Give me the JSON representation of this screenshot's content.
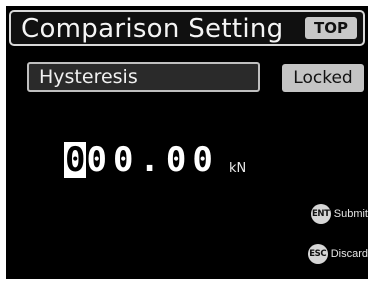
{
  "header": {
    "title": "Comparison Setting",
    "top_button": "TOP"
  },
  "field": {
    "mode": "Hysteresis",
    "lock_status": "Locked"
  },
  "value": {
    "cursor_digit": "0",
    "rest": "00.00",
    "unit": "kN"
  },
  "keys": [
    {
      "key": "ENT",
      "label": "Submit"
    },
    {
      "key": "ESC",
      "label": "Discard"
    }
  ]
}
